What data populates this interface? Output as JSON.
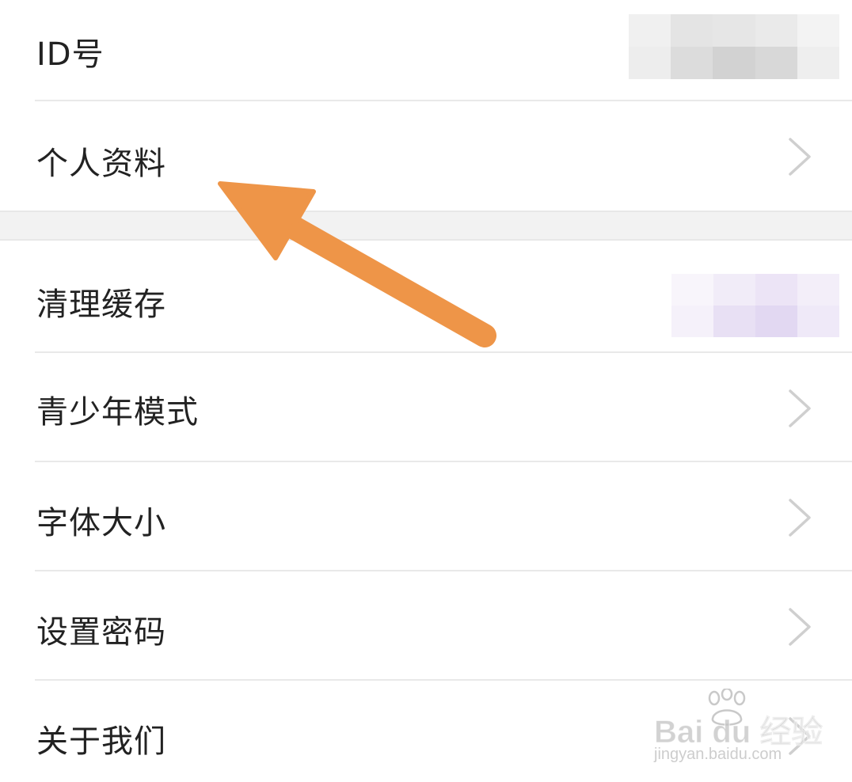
{
  "settings": {
    "items": [
      {
        "label": "ID号"
      },
      {
        "label": "个人资料"
      },
      {
        "label": "清理缓存"
      },
      {
        "label": "青少年模式"
      },
      {
        "label": "字体大小"
      },
      {
        "label": "设置密码"
      },
      {
        "label": "关于我们"
      }
    ]
  },
  "annotation": {
    "arrow_color": "#EE9548"
  },
  "watermark": {
    "brand_text": "Bai du 经验",
    "domain_text": "jingyan.baidu.com"
  },
  "icons": {
    "row_chevron": "chevron-right-icon",
    "watermark_paw": "baidu-paw-icon"
  }
}
